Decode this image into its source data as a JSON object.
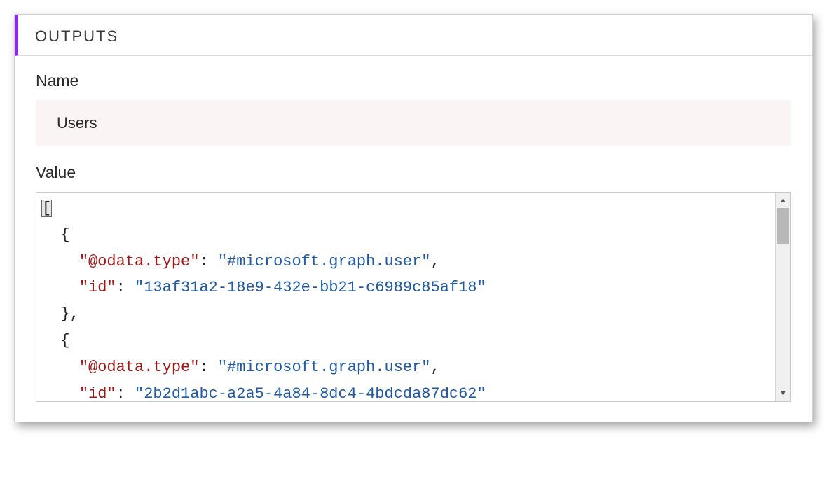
{
  "outputs": {
    "header_title": "OUTPUTS",
    "name_label": "Name",
    "name_value": "Users",
    "value_label": "Value",
    "json_tokens": [
      {
        "t": "bracket-hl",
        "v": "["
      },
      {
        "t": "nl"
      },
      {
        "t": "indent",
        "v": "  "
      },
      {
        "t": "punc",
        "v": "{"
      },
      {
        "t": "nl"
      },
      {
        "t": "indent",
        "v": "    "
      },
      {
        "t": "key",
        "v": "\"@odata.type\""
      },
      {
        "t": "punc",
        "v": ": "
      },
      {
        "t": "str",
        "v": "\"#microsoft.graph.user\""
      },
      {
        "t": "punc",
        "v": ","
      },
      {
        "t": "nl"
      },
      {
        "t": "indent",
        "v": "    "
      },
      {
        "t": "key",
        "v": "\"id\""
      },
      {
        "t": "punc",
        "v": ": "
      },
      {
        "t": "str",
        "v": "\"13af31a2-18e9-432e-bb21-c6989c85af18\""
      },
      {
        "t": "nl"
      },
      {
        "t": "indent",
        "v": "  "
      },
      {
        "t": "punc",
        "v": "},"
      },
      {
        "t": "nl"
      },
      {
        "t": "indent",
        "v": "  "
      },
      {
        "t": "punc",
        "v": "{"
      },
      {
        "t": "nl"
      },
      {
        "t": "indent",
        "v": "    "
      },
      {
        "t": "key",
        "v": "\"@odata.type\""
      },
      {
        "t": "punc",
        "v": ": "
      },
      {
        "t": "str",
        "v": "\"#microsoft.graph.user\""
      },
      {
        "t": "punc",
        "v": ","
      },
      {
        "t": "nl"
      },
      {
        "t": "indent",
        "v": "    "
      },
      {
        "t": "key",
        "v": "\"id\""
      },
      {
        "t": "punc",
        "v": ": "
      },
      {
        "t": "str",
        "v": "\"2b2d1abc-a2a5-4a84-8dc4-4bdcda87dc62\""
      }
    ]
  }
}
